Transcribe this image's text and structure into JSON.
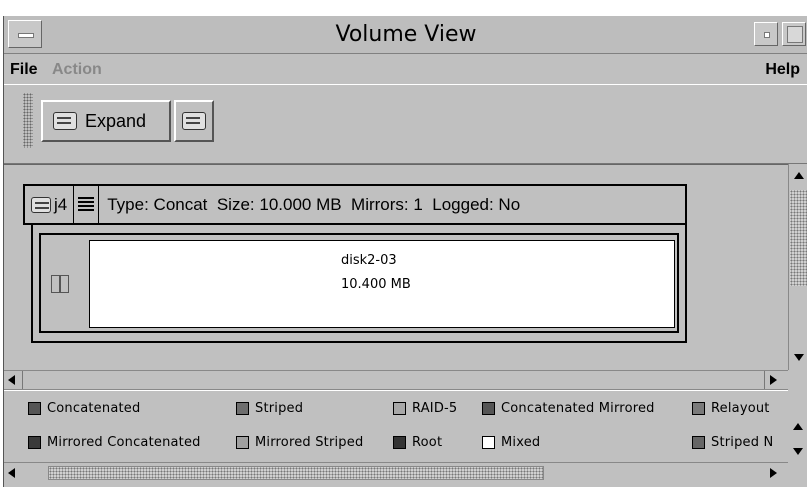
{
  "window": {
    "title": "Volume View"
  },
  "menu": {
    "file": "File",
    "action": "Action",
    "help": "Help"
  },
  "toolbar": {
    "expand_label": "Expand"
  },
  "volume": {
    "name": "j4",
    "info": "Type: Concat  Size: 10.000 MB  Mirrors: 1  Logged: No",
    "subdisk": {
      "name": "disk2-03",
      "size": "10.400 MB"
    }
  },
  "legend": {
    "items": [
      {
        "label": "Concatenated",
        "color": "#555555"
      },
      {
        "label": "Striped",
        "color": "#6e6e6e"
      },
      {
        "label": "RAID-5",
        "color": "#a8a8a8"
      },
      {
        "label": "Concatenated Mirrored",
        "color": "#555555"
      },
      {
        "label": "Relayout",
        "color": "#7a7a7a"
      },
      {
        "label": "Mirrored Concatenated",
        "color": "#3a3a3a"
      },
      {
        "label": "Mirrored Striped",
        "color": "#a0a0a0"
      },
      {
        "label": "Root",
        "color": "#333333"
      },
      {
        "label": "Mixed",
        "color": "#ffffff"
      },
      {
        "label": "Striped N",
        "color": "#666666"
      }
    ]
  }
}
